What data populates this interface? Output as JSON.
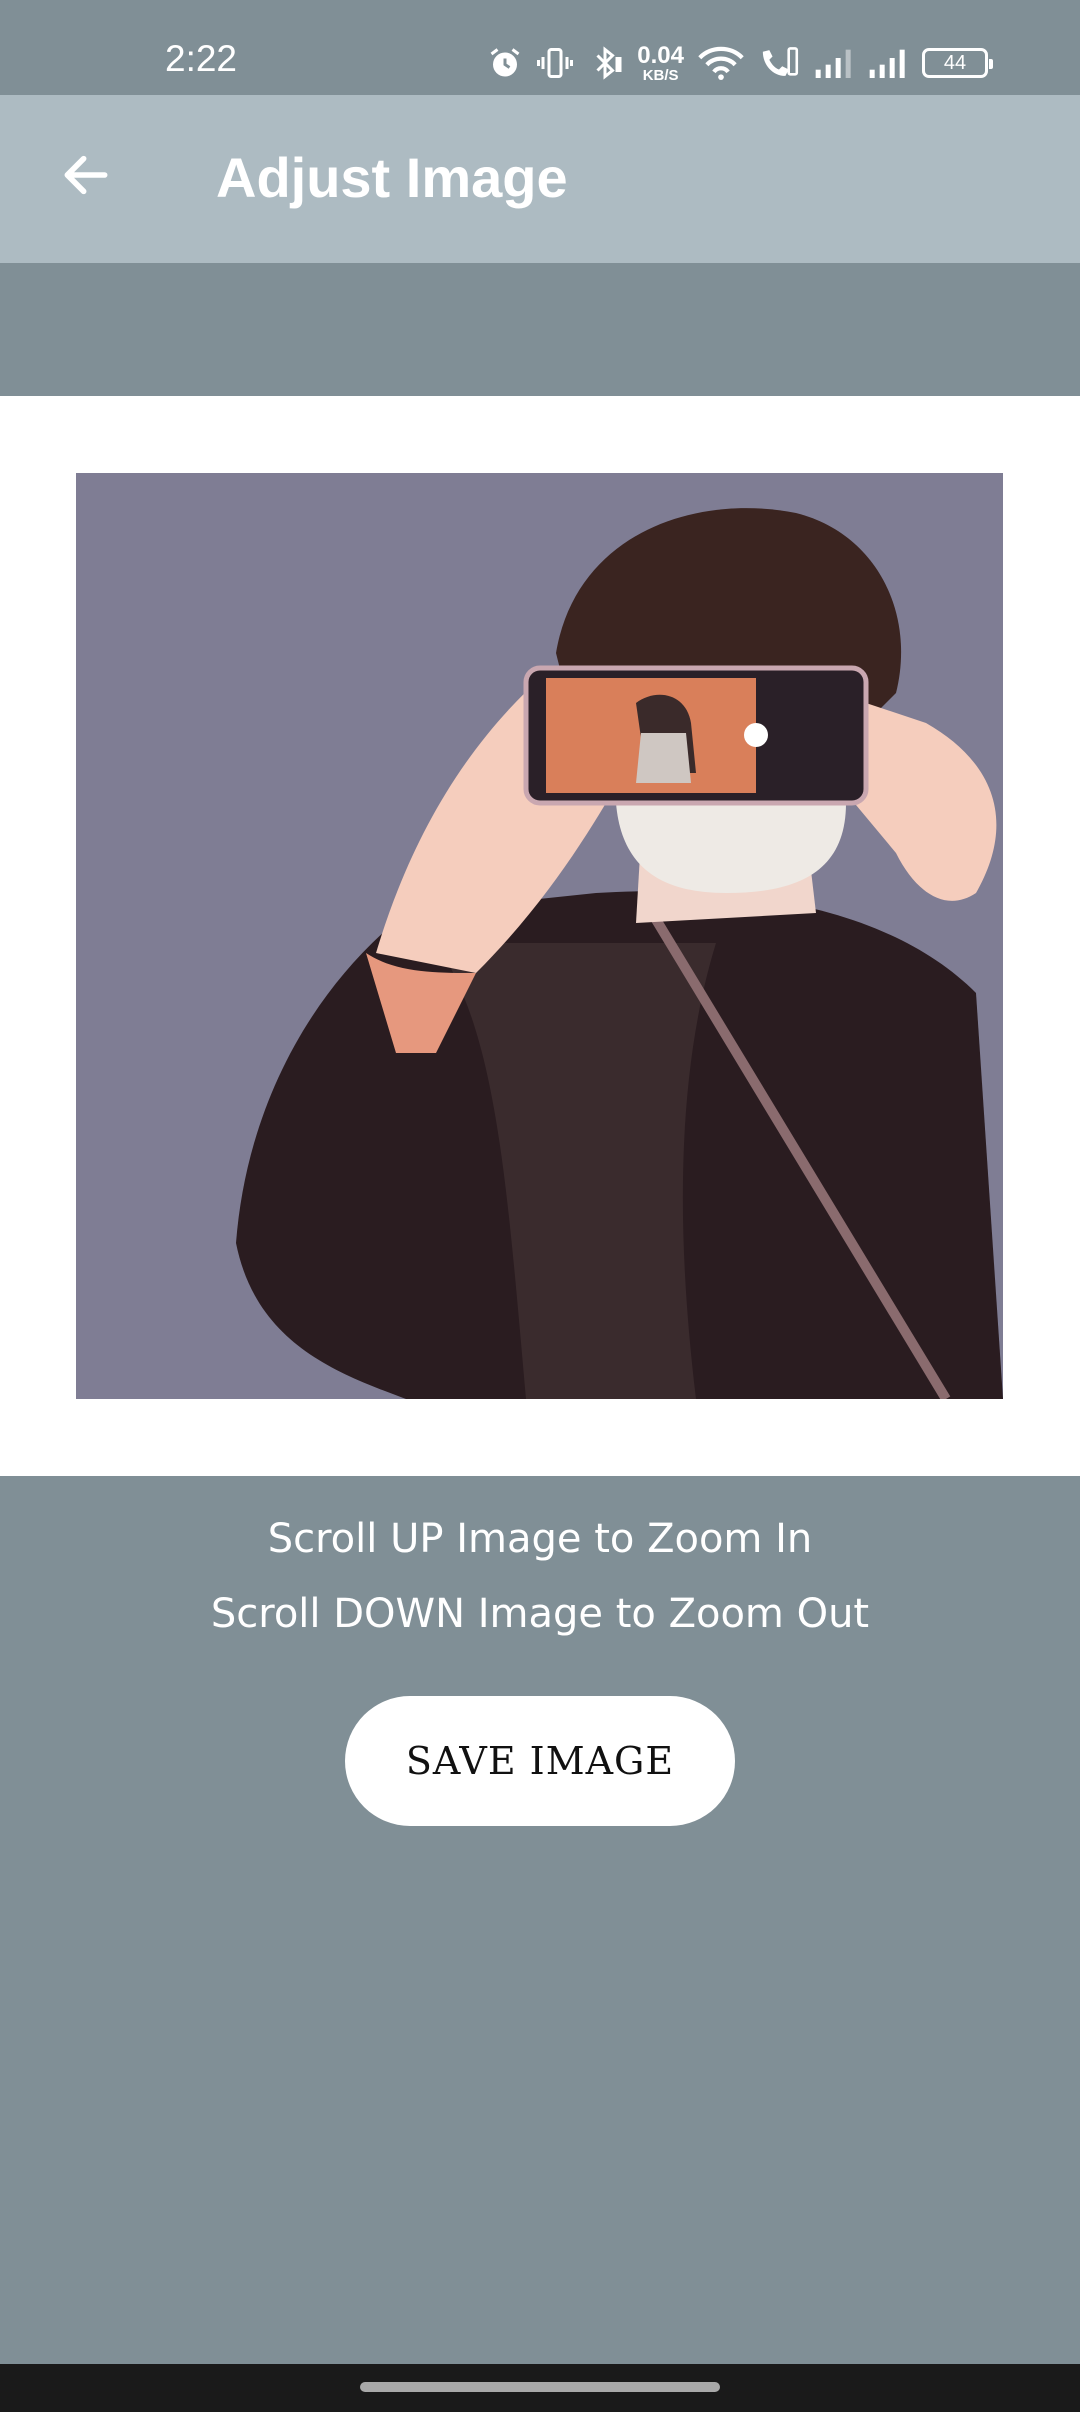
{
  "status_bar": {
    "time": "2:22",
    "net_speed_value": "0.04",
    "net_speed_unit": "KB/S",
    "battery_level": "44",
    "icons": [
      "alarm-icon",
      "vibrate-icon",
      "bluetooth-icon",
      "wifi-icon",
      "volte-call-icon",
      "signal-icon",
      "signal-icon",
      "battery-icon"
    ]
  },
  "app_bar": {
    "title": "Adjust Image",
    "back_icon": "arrow-left-icon"
  },
  "instructions": {
    "line1": "Scroll UP Image to Zoom In",
    "line2": "Scroll DOWN Image to Zoom Out"
  },
  "actions": {
    "save_label": "SAVE IMAGE"
  },
  "colors": {
    "background": "#808f96",
    "app_bar": "#adbbc2",
    "panel": "#ffffff",
    "image_bg": "#7f7d94"
  }
}
